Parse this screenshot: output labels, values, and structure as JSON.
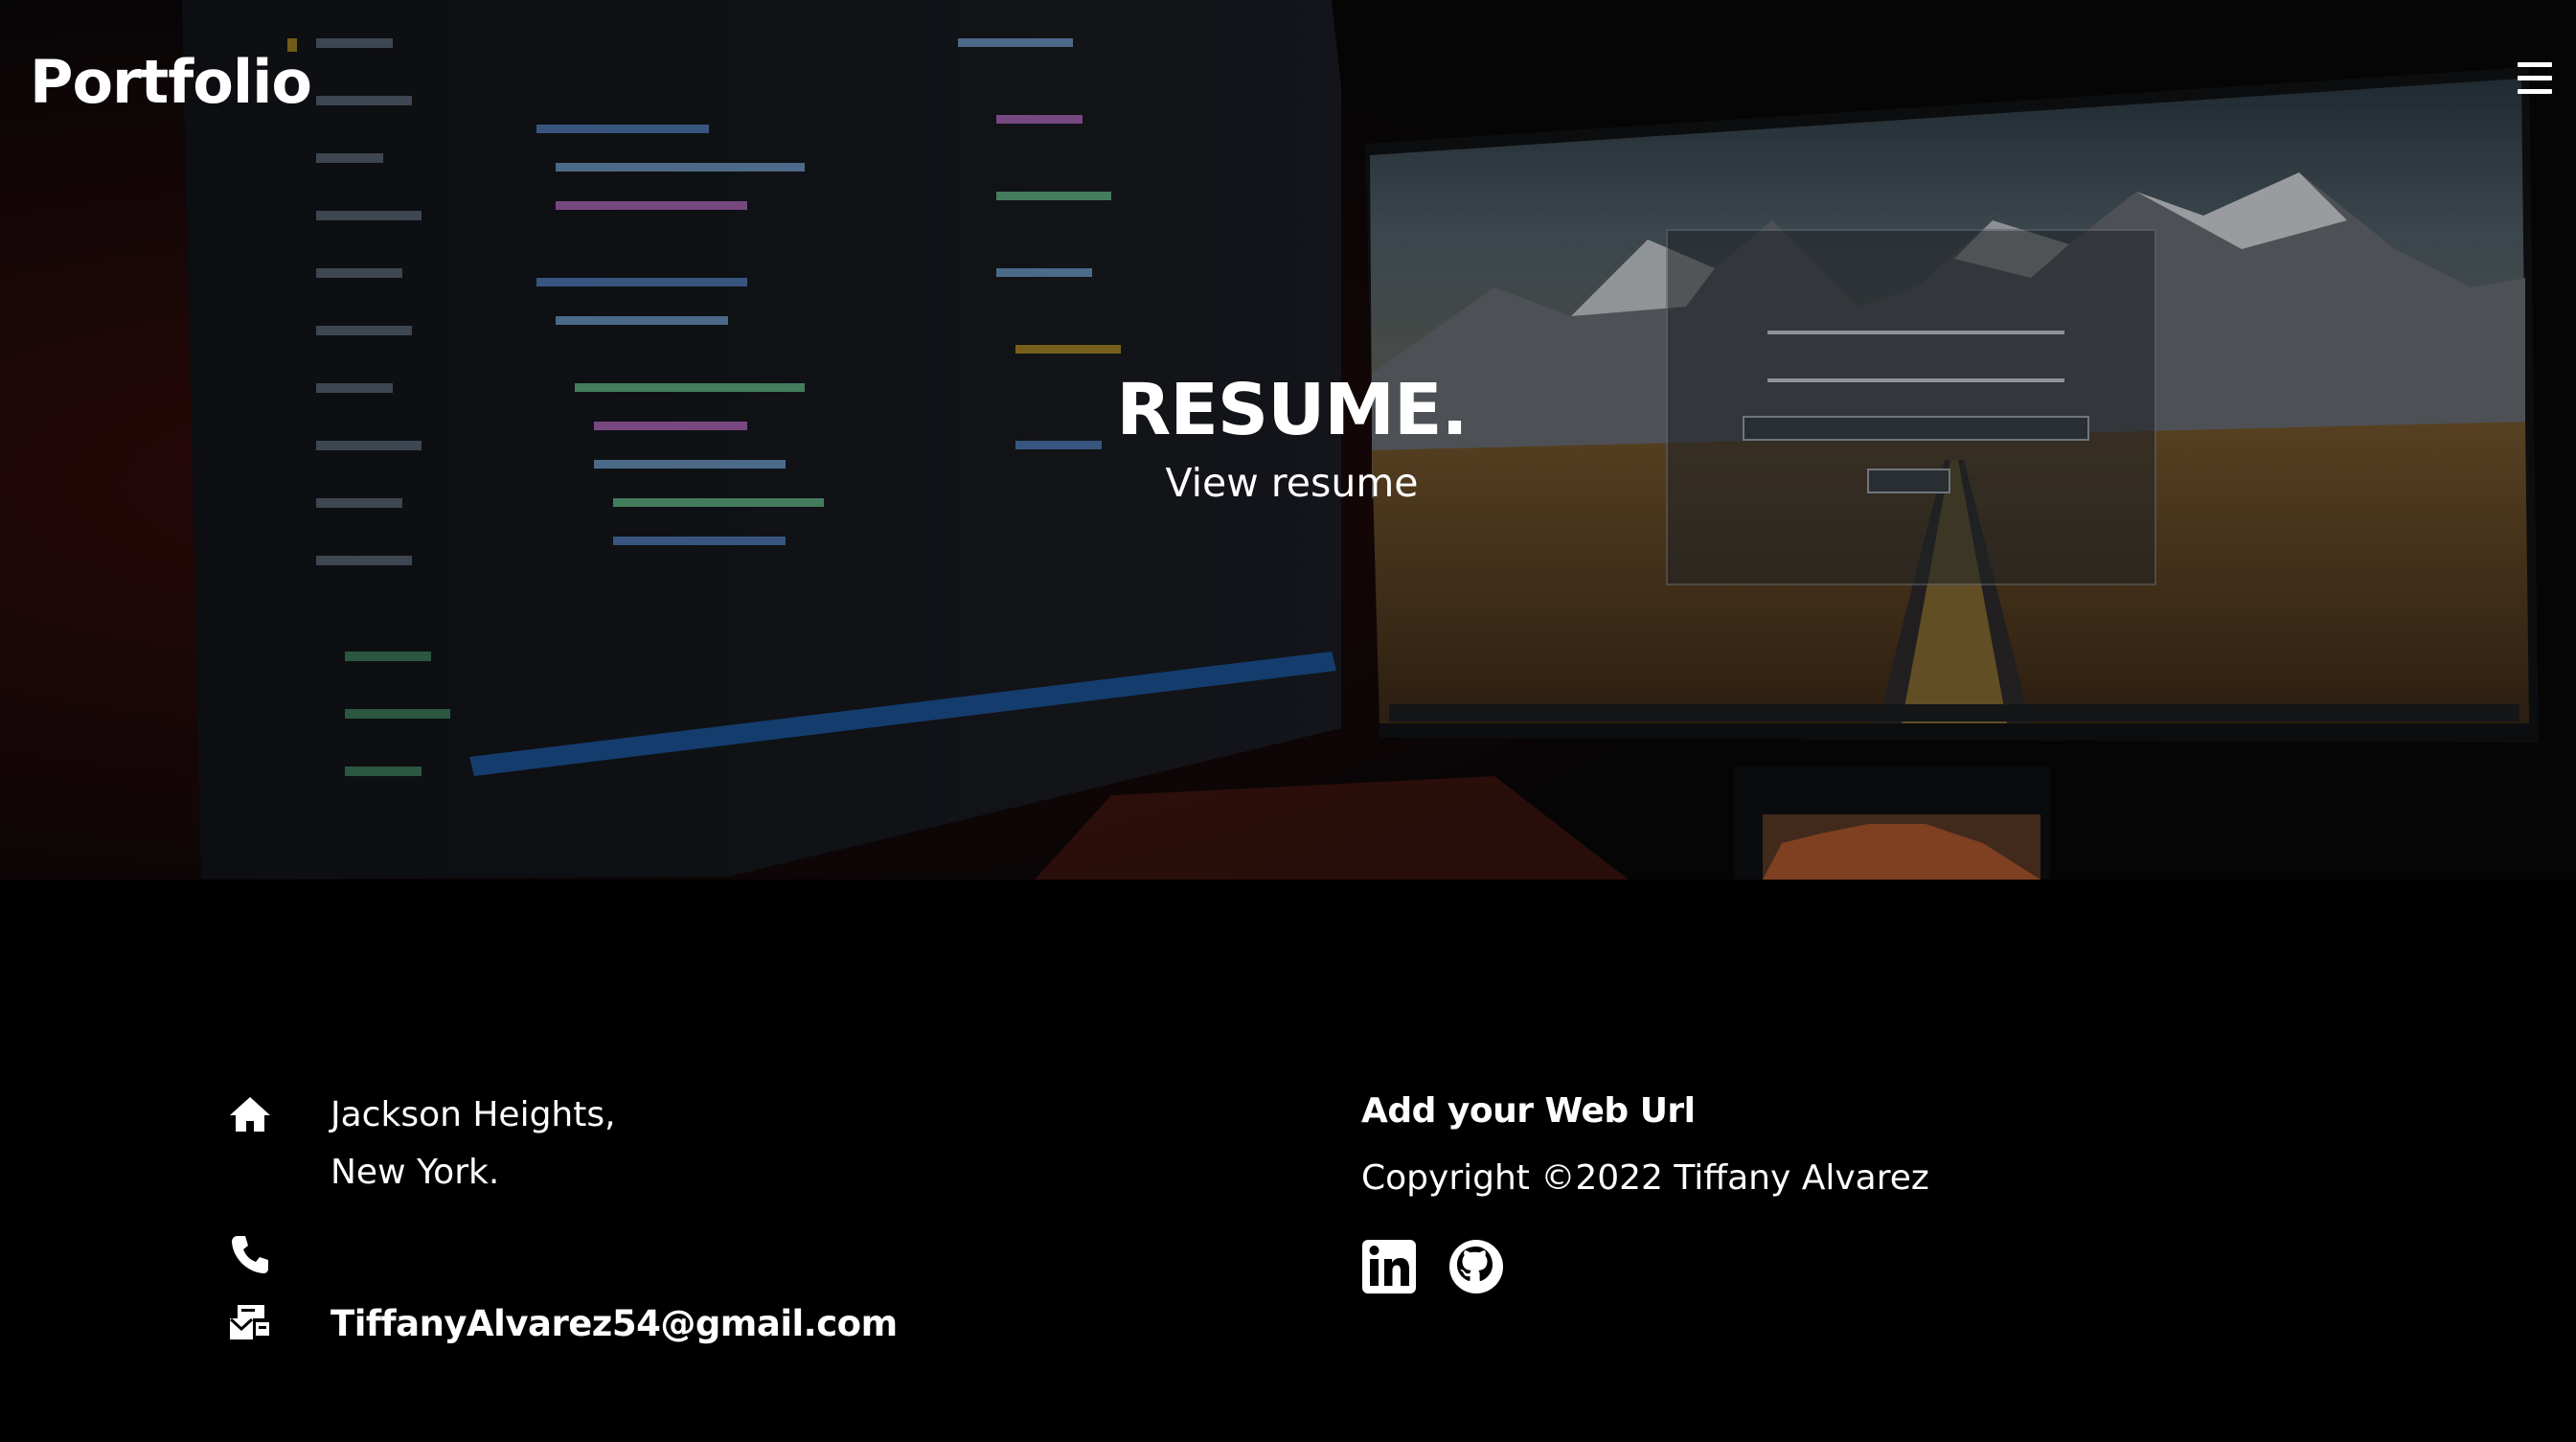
{
  "brand": {
    "title": "Portfolio",
    "icon": "hamburger-menu-icon"
  },
  "hero": {
    "title": "RESUME.",
    "link_label": "View resume",
    "background": "photo of desk with code monitor and mountain landscape monitor"
  },
  "footer": {
    "address": {
      "icon": "home-icon",
      "line1": "Jackson Heights,",
      "line2": "New York."
    },
    "phone": {
      "icon": "phone-icon",
      "value": ""
    },
    "email": {
      "icon": "mail-icon",
      "value": "TiffanyAlvarez54@gmail.com"
    },
    "web_url_label": "Add your Web Url",
    "copyright": "Copyright ©2022 Tiffany Alvarez",
    "social": [
      {
        "name": "LinkedIn",
        "icon": "linkedin-icon"
      },
      {
        "name": "GitHub",
        "icon": "github-icon"
      }
    ]
  },
  "colors": {
    "background": "#000000",
    "text": "#ffffff",
    "accent_orange": "#c98a3b"
  }
}
